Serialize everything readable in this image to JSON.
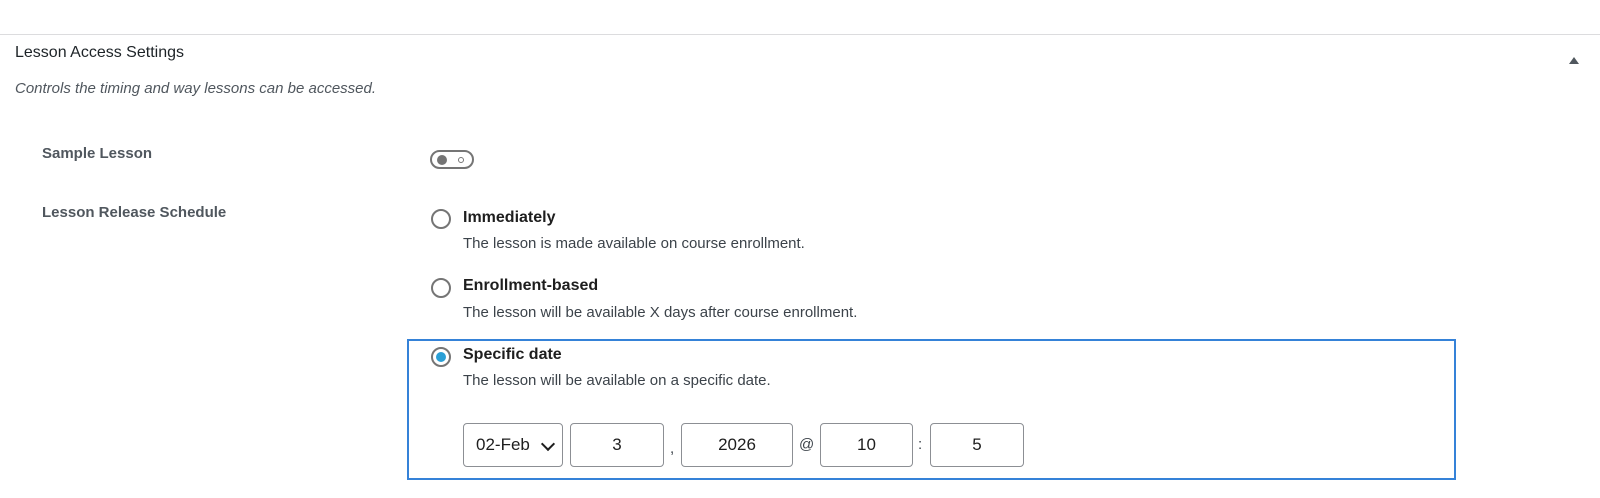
{
  "panel": {
    "title": "Lesson Access Settings",
    "description": "Controls the timing and way lessons can be accessed."
  },
  "sample_lesson": {
    "label": "Sample Lesson",
    "enabled": false
  },
  "release_schedule": {
    "label": "Lesson Release Schedule",
    "selected": "specific",
    "options": [
      {
        "id": "immediately",
        "label": "Immediately",
        "description": "The lesson is made available on course enrollment."
      },
      {
        "id": "enrollment",
        "label": "Enrollment-based",
        "description": "The lesson will be available X days after course enrollment."
      },
      {
        "id": "specific",
        "label": "Specific date",
        "description": "The lesson will be available on a specific date."
      }
    ],
    "date": {
      "month": "02-Feb",
      "day": "3",
      "year": "2026",
      "hour": "10",
      "minute": "5",
      "sep_comma": ",",
      "sep_at": "@",
      "sep_colon": ":"
    }
  },
  "colors": {
    "accent": "#2a9fd6",
    "focus_border": "#3582d8"
  }
}
